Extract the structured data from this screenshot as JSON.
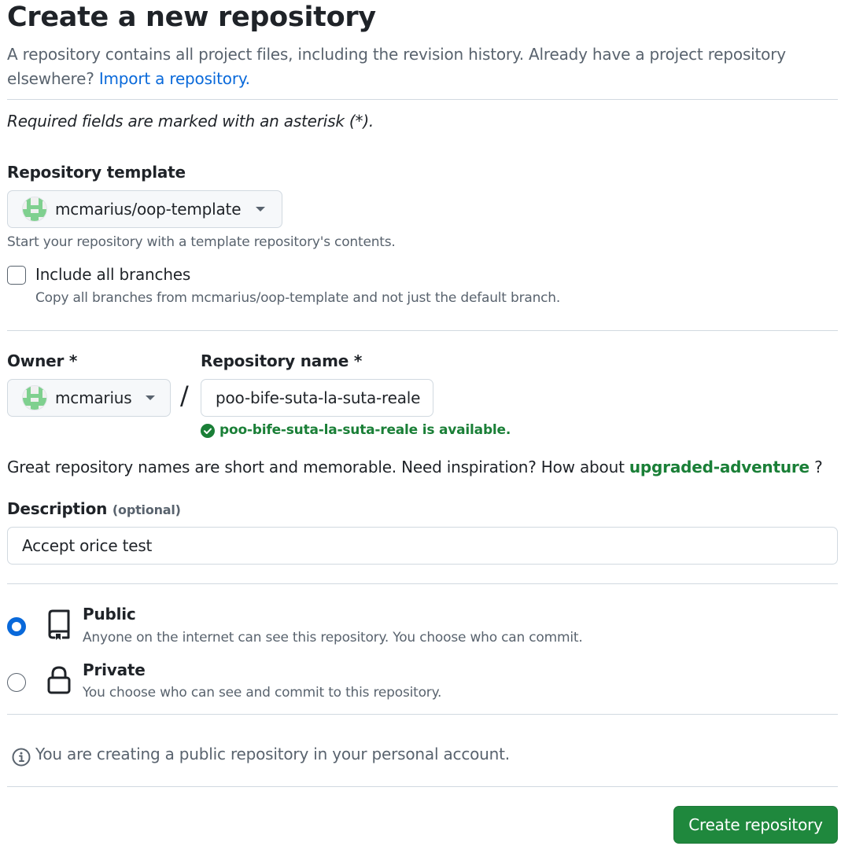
{
  "header": {
    "title": "Create a new repository",
    "intro_text": "A repository contains all project files, including the revision history. Already have a project repository elsewhere?",
    "import_link": "Import a repository."
  },
  "required_note": "Required fields are marked with an asterisk (*).",
  "template": {
    "label": "Repository template",
    "selected": "mcmarius/oop-template",
    "help": "Start your repository with a template repository's contents.",
    "include_branches_label": "Include all branches",
    "include_branches_checked": false,
    "include_branches_help": "Copy all branches from mcmarius/oop-template and not just the default branch."
  },
  "owner": {
    "label": "Owner *",
    "selected": "mcmarius"
  },
  "separator": "/",
  "repo_name": {
    "label": "Repository name *",
    "value": "poo-bife-suta-la-suta-reale",
    "availability": "poo-bife-suta-la-suta-reale is available."
  },
  "suggestion": {
    "text": "Great repository names are short and memorable. Need inspiration? How about",
    "name": "upgraded-adventure",
    "suffix": "?"
  },
  "description": {
    "label": "Description",
    "optional": "(optional)",
    "value": "Accept orice test"
  },
  "visibility": {
    "selected": "public",
    "public": {
      "title": "Public",
      "desc": "Anyone on the internet can see this repository. You choose who can commit."
    },
    "private": {
      "title": "Private",
      "desc": "You choose who can see and commit to this repository."
    }
  },
  "info_note": "You are creating a public repository in your personal account.",
  "submit_label": "Create repository",
  "colors": {
    "primary_button": "#1f883d",
    "link": "#0969da",
    "success": "#1a7f37",
    "avatar_green": "#7fd08f"
  },
  "icons": [
    "avatar-identicon",
    "caret-down-icon",
    "check-circle-icon",
    "repo-icon",
    "lock-icon",
    "info-icon"
  ]
}
